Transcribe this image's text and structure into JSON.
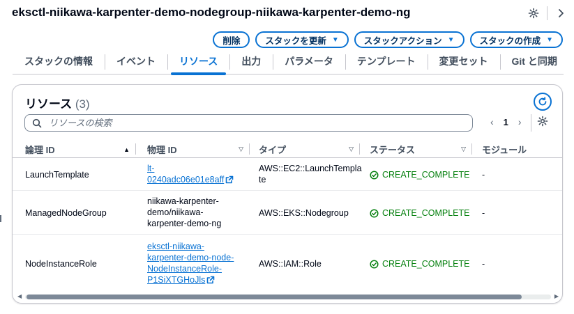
{
  "header": {
    "title": "eksctl-niikawa-karpenter-demo-nodegroup-niikawa-karpenter-demo-ng",
    "icons": [
      "gear-icon",
      "chevron-right-icon"
    ]
  },
  "actions": {
    "delete": "削除",
    "update": "スタックを更新",
    "stack_actions": "スタックアクション",
    "create": "スタックの作成"
  },
  "tabs": [
    {
      "label": "スタックの情報"
    },
    {
      "label": "イベント"
    },
    {
      "label": "リソース"
    },
    {
      "label": "出力"
    },
    {
      "label": "パラメータ"
    },
    {
      "label": "テンプレート"
    },
    {
      "label": "変更セット"
    },
    {
      "label": "Git と同期"
    }
  ],
  "active_tab": "リソース",
  "panel": {
    "title": "リソース",
    "count": "(3)",
    "search_placeholder": "リソースの検索",
    "page": "1"
  },
  "columns": [
    "論理 ID",
    "物理 ID",
    "タイプ",
    "ステータス",
    "モジュール"
  ],
  "rows": [
    {
      "logical_id": "LaunchTemplate",
      "physical_id_1": "lt-",
      "physical_id_2": "0240adc06e01e8aff",
      "type_1": "AWS::EC2::LaunchTempla",
      "type_2": "te",
      "status": "CREATE_COMPLETE",
      "module": "-"
    },
    {
      "logical_id": "ManagedNodeGroup",
      "physical_id_1": "niikawa-karpenter-",
      "physical_id_2": "demo/niikawa-",
      "physical_id_3": "karpenter-demo-ng",
      "type": "AWS::EKS::Nodegroup",
      "status": "CREATE_COMPLETE",
      "module": "-"
    },
    {
      "logical_id": "NodeInstanceRole",
      "physical_id_1": "eksctl-niikawa-",
      "physical_id_2": "karpenter-demo-node-",
      "physical_id_3": "NodeInstanceRole-",
      "physical_id_4": "P1SiXTGHoJls",
      "type": "AWS::IAM::Role",
      "status": "CREATE_COMPLETE",
      "module": "-"
    }
  ],
  "colors": {
    "accent": "#0972d3",
    "success": "#037f0c",
    "text": "#000716",
    "border": "#c6c6cd"
  }
}
